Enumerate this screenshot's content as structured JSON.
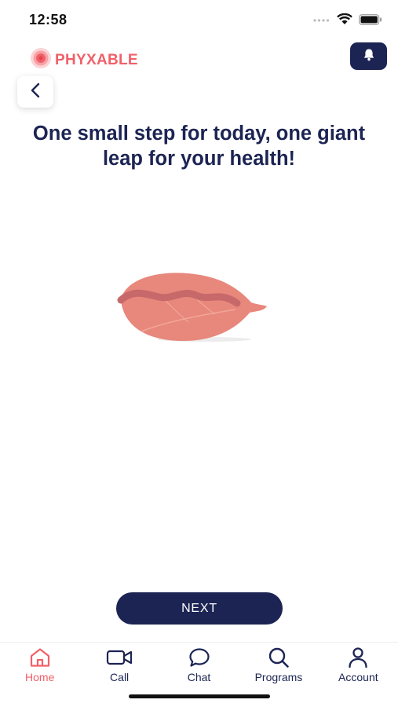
{
  "status_bar": {
    "time": "12:58"
  },
  "header": {
    "brand": "PHYXABLE"
  },
  "main": {
    "headline": "One small step for today, one giant leap for your health!"
  },
  "actions": {
    "next_label": "NEXT"
  },
  "tab_bar": {
    "items": [
      {
        "label": "Home",
        "icon": "home-icon",
        "active": true
      },
      {
        "label": "Call",
        "icon": "video-icon",
        "active": false
      },
      {
        "label": "Chat",
        "icon": "chat-bubble-icon",
        "active": false
      },
      {
        "label": "Programs",
        "icon": "search-icon",
        "active": false
      },
      {
        "label": "Account",
        "icon": "person-icon",
        "active": false
      }
    ]
  },
  "colors": {
    "navy": "#1c2453",
    "brand_coral": "#f0606a",
    "leaf": "#e8877b"
  }
}
